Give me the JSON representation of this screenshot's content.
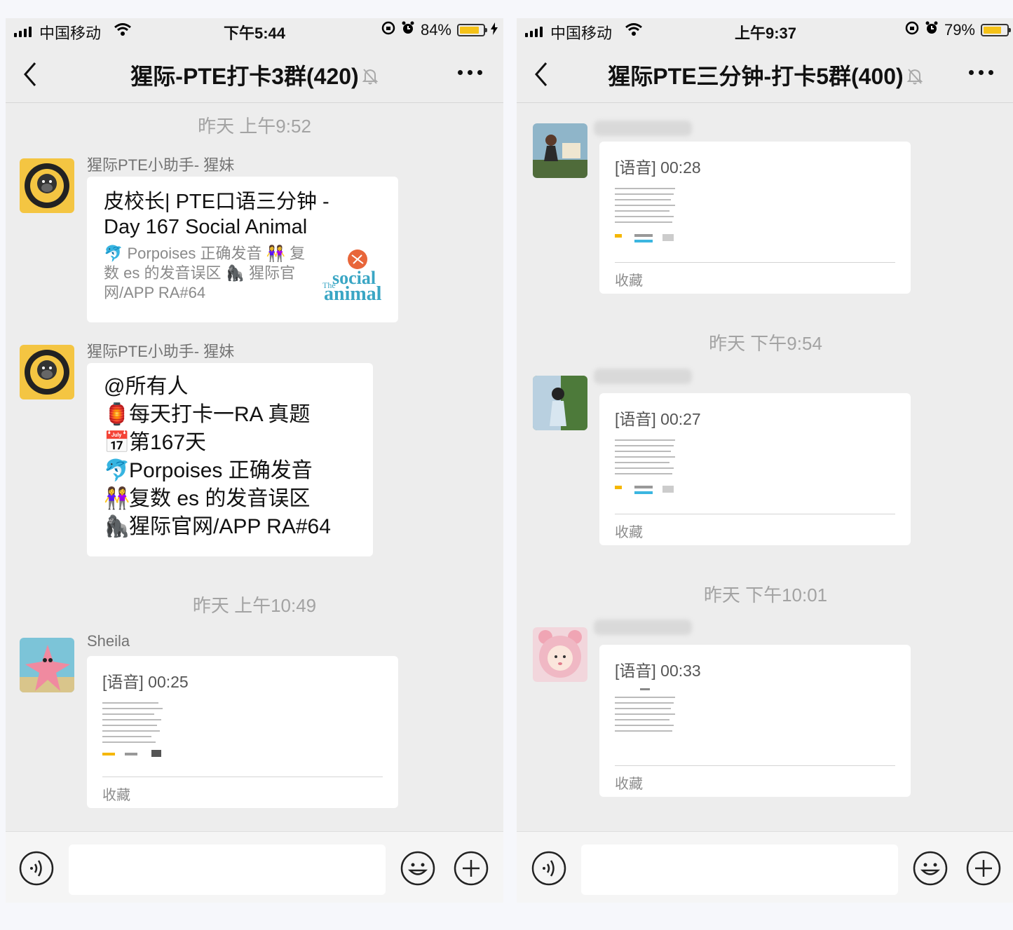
{
  "left": {
    "status": {
      "carrier": "中国移动",
      "time": "下午5:44",
      "battery_text": "84%",
      "battery_level": 0.84
    },
    "nav": {
      "title": "猩际-PTE打卡3群(420)"
    },
    "timestamps": [
      "昨天 上午9:52",
      "昨天 上午10:49"
    ],
    "messages": [
      {
        "sender": "猩际PTE小助手- 猩妹",
        "link_title": "皮校长| PTE口语三分钟 - Day 167 Social Animal",
        "link_desc": "🐬 Porpoises 正确发音 👭 复数 es 的发音误区 🦍 猩际官网/APP RA#64",
        "thumb_small": "The",
        "thumb_line1": "social",
        "thumb_line2": "animal"
      },
      {
        "sender": "猩际PTE小助手- 猩妹",
        "lines": [
          {
            "emoji": "",
            "text": "@所有人"
          },
          {
            "emoji": "🏮",
            "text": "每天打卡一RA 真题"
          },
          {
            "emoji": "📅",
            "text": "第167天"
          },
          {
            "emoji": "🐬",
            "text": "Porpoises 正确发音"
          },
          {
            "emoji": "👭",
            "text": "复数 es 的发音误区"
          },
          {
            "emoji": "🦍",
            "text": "猩际官网/APP RA#64"
          }
        ]
      },
      {
        "sender": "Sheila",
        "voice": "[语音] 00:25",
        "fav": "收藏"
      }
    ]
  },
  "right": {
    "status": {
      "carrier": "中国移动",
      "time": "上午9:37",
      "battery_text": "79%",
      "battery_level": 0.79
    },
    "nav": {
      "title": "猩际PTE三分钟-打卡5群(400)"
    },
    "timestamps": [
      "昨天 下午9:54",
      "昨天 下午10:01"
    ],
    "messages": [
      {
        "voice": "[语音] 00:28",
        "fav": "收藏"
      },
      {
        "voice": "[语音] 00:27",
        "fav": "收藏"
      },
      {
        "voice": "[语音] 00:33",
        "fav": "收藏"
      }
    ]
  },
  "colors": {
    "chat_bg": "#ededed",
    "bubble": "#ffffff",
    "battery_fill": "#f5c218",
    "timestamp": "#a3a3a3"
  },
  "icons": [
    "signal-icon",
    "wifi-icon",
    "lock-rotation-icon",
    "alarm-icon",
    "battery-icon",
    "charging-icon",
    "back-icon",
    "mute-bell-icon",
    "more-icon",
    "voice-icon",
    "emoji-icon",
    "plus-icon"
  ]
}
